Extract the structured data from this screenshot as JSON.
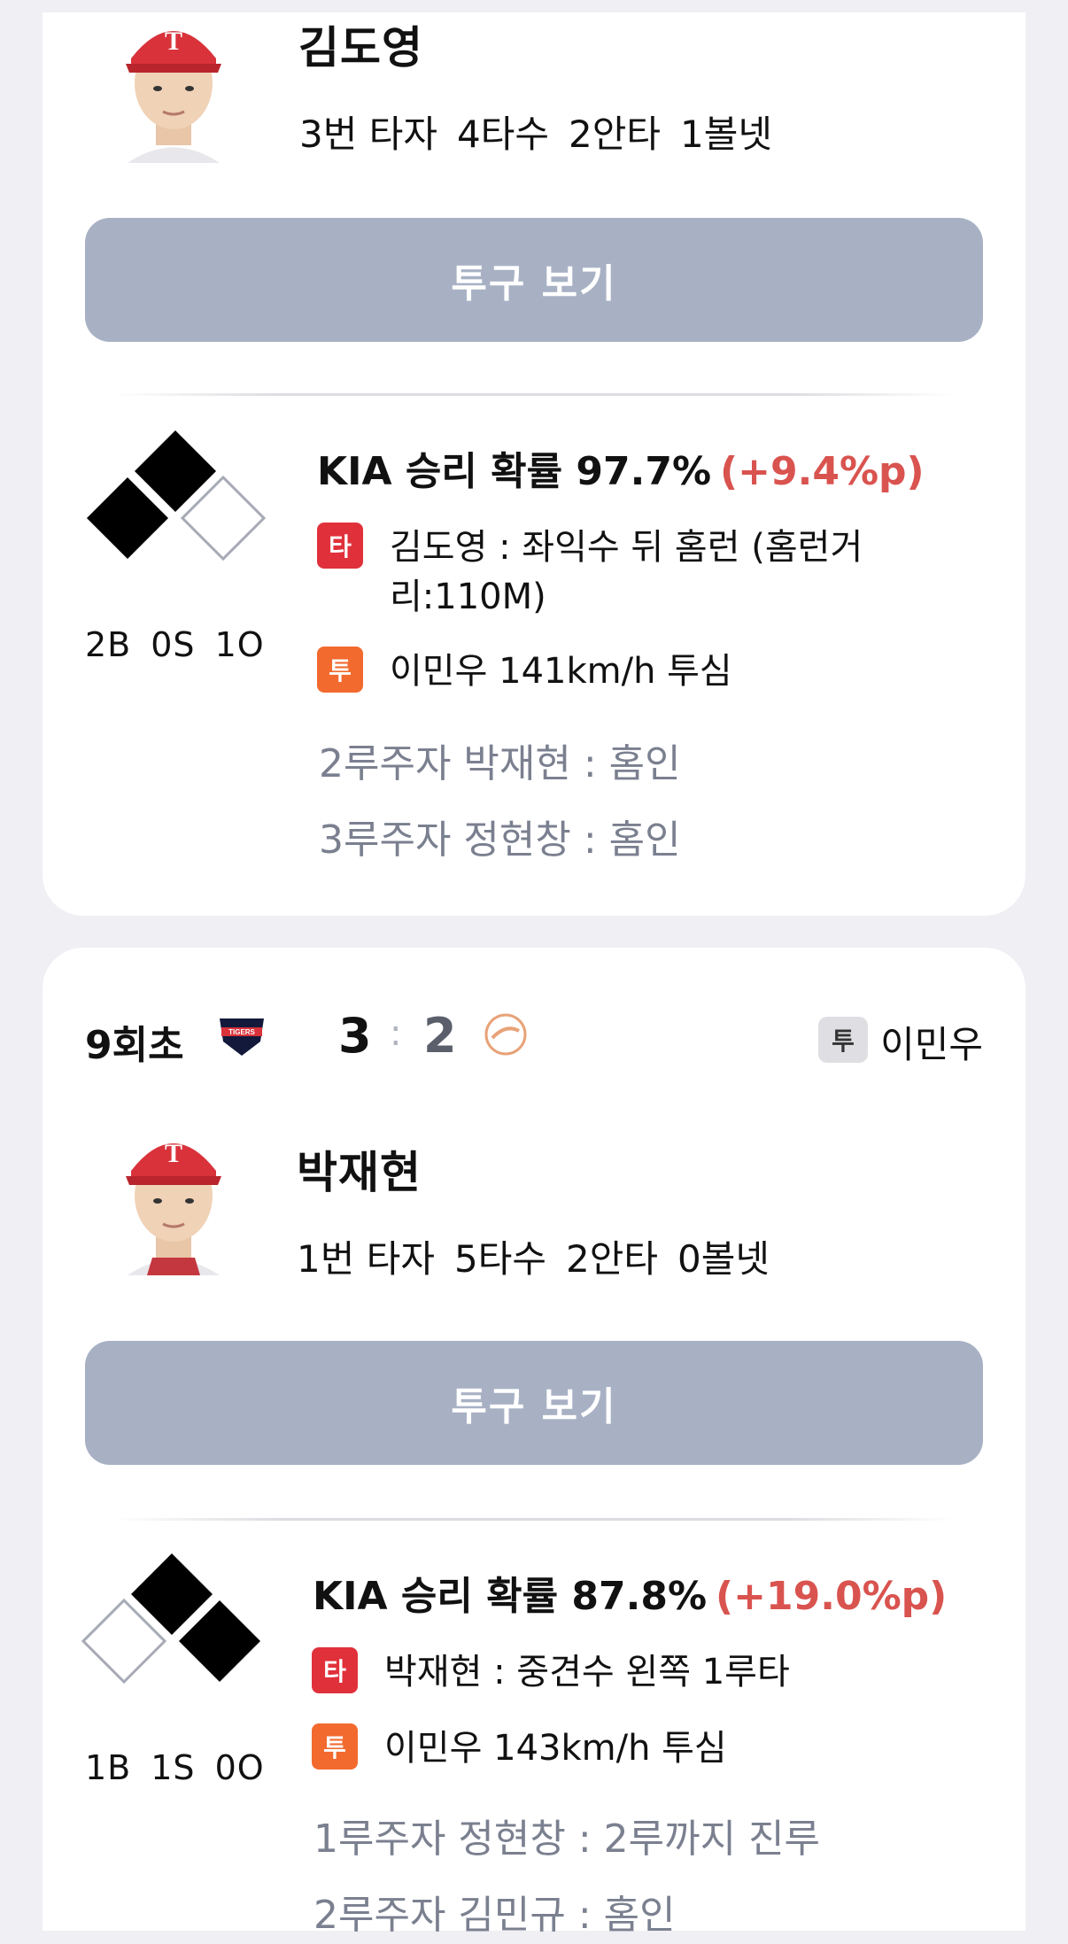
{
  "cards": [
    {
      "player": {
        "name": "김도영",
        "order": "3번 타자",
        "ab": "4타수",
        "hits": "2안타",
        "walks": "1볼넷"
      },
      "pitch_button": "투구 보기",
      "count": {
        "b": "2B",
        "s": "0S",
        "o": "1O"
      },
      "bases": {
        "first": false,
        "second": true,
        "third": true
      },
      "win_prob": {
        "text": "KIA 승리 확률 97.7%",
        "delta": "(+9.4%p)"
      },
      "events": [
        {
          "tag": "타",
          "text": "김도영 : 좌익수 뒤 홈런 (홈런거리:110M)"
        },
        {
          "tag": "투",
          "text": "이민우 141km/h 투심"
        }
      ],
      "runners": [
        "2루주자 박재현 : 홈인",
        "3루주자 정현창 : 홈인"
      ]
    },
    {
      "header": {
        "inning": "9회초",
        "home_score": "3",
        "separator": ":",
        "away_score": "2",
        "pitcher_tag": "투",
        "pitcher": "이민우"
      },
      "player": {
        "name": "박재현",
        "order": "1번 타자",
        "ab": "5타수",
        "hits": "2안타",
        "walks": "0볼넷"
      },
      "pitch_button": "투구 보기",
      "count": {
        "b": "1B",
        "s": "1S",
        "o": "0O"
      },
      "bases": {
        "first": true,
        "second": true,
        "third": false
      },
      "win_prob": {
        "text": "KIA 승리 확률 87.8%",
        "delta": "(+19.0%p)"
      },
      "events": [
        {
          "tag": "타",
          "text": "박재현 : 중견수 왼쪽 1루타"
        },
        {
          "tag": "투",
          "text": "이민우 143km/h 투심"
        }
      ],
      "runners": [
        "1루주자 정현창 : 2루까지 진루",
        "2루주자 김민규 : 홈인"
      ]
    }
  ],
  "icons": {
    "home_logo": "tigers-logo-icon",
    "away_logo": "eagles-logo-icon",
    "avatar": "player-avatar-icon",
    "bases": "base-diamond-icon"
  },
  "colors": {
    "batter_tag": "#E0313B",
    "pitcher_tag": "#F26A2E",
    "delta": "#D9534F",
    "button": "#A8B1C4"
  }
}
